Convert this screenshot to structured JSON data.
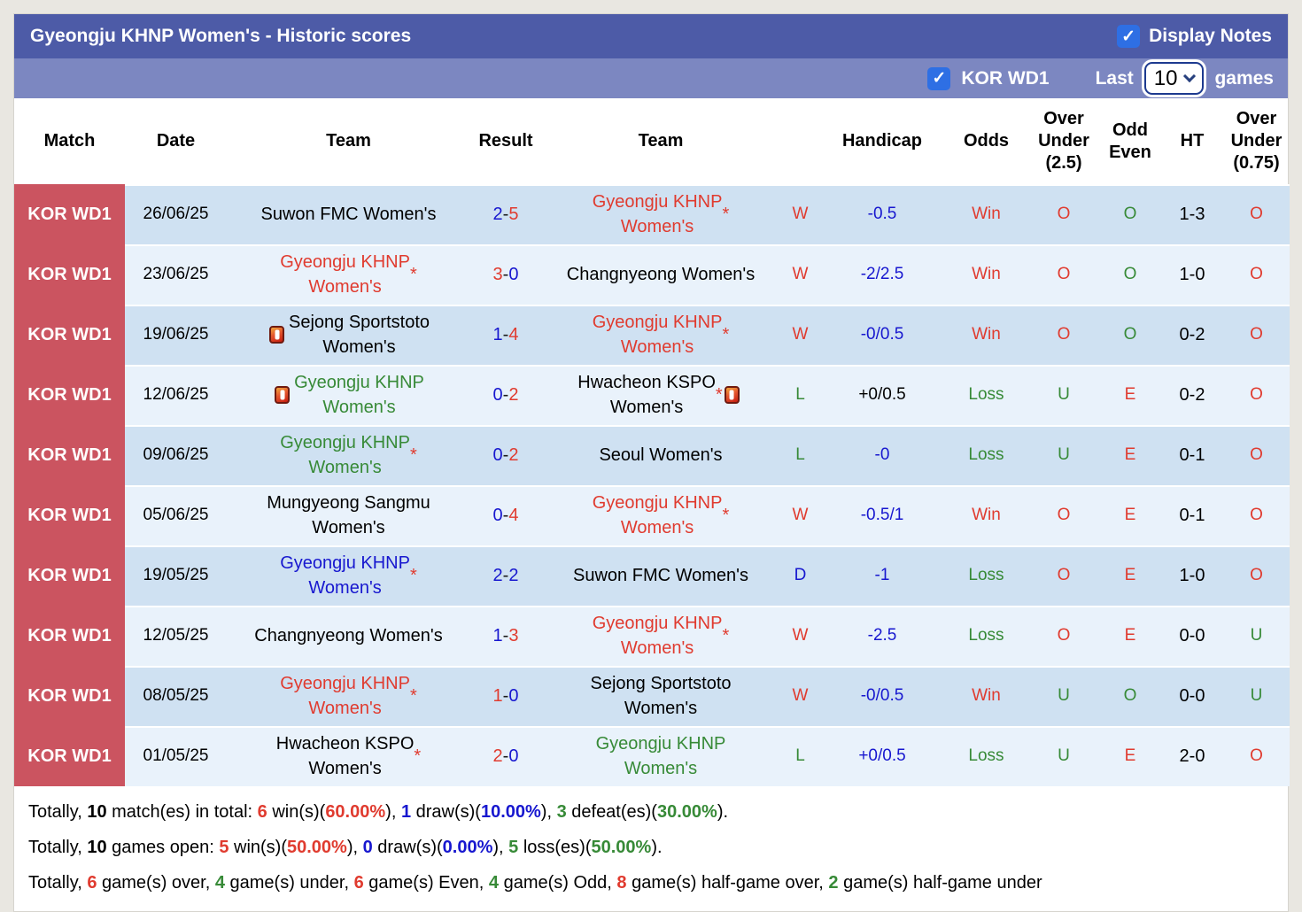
{
  "header": {
    "title": "Gyeongju KHNP Women's - Historic scores",
    "display_notes_label": "Display Notes"
  },
  "filter_bar": {
    "league_label": "KOR WD1",
    "last_label": "Last",
    "games_count": "10",
    "games_label": "games"
  },
  "colors": {
    "header_dark": "#4d5ba7",
    "header_light": "#7c87c1",
    "badge_red": "#cb5460",
    "row_odd": "#cfe1f2",
    "row_even": "#e9f2fb",
    "checkbox_blue": "#2e6fe4",
    "win_red": "#e03b2f",
    "loss_green": "#378a37",
    "draw_blue": "#1717cf"
  },
  "table": {
    "columns": [
      "Match",
      "Date",
      "Team",
      "Result",
      "Team",
      "",
      "Handicap",
      "Odds",
      "Over\nUnder\n(2.5)",
      "Odd\nEven",
      "HT",
      "Over\nUnder\n(0.75)"
    ],
    "rows": [
      {
        "league": "KOR WD1",
        "date": "26/06/25",
        "home": {
          "name": "Suwon FMC Women's",
          "color": "black",
          "star": false,
          "card_before": false,
          "card_after": false
        },
        "result": {
          "home": "2",
          "away": "5",
          "home_color": "blue",
          "away_color": "red"
        },
        "away": {
          "name": "Gyeongju KHNP\nWomen's",
          "color": "red",
          "star": true,
          "card_before": false,
          "card_after": false
        },
        "outcome": {
          "text": "W",
          "color": "red"
        },
        "handicap": {
          "text": "-0.5",
          "color": "blue"
        },
        "odds": {
          "text": "Win",
          "color": "red"
        },
        "over_under_25": {
          "text": "O",
          "color": "red"
        },
        "odd_even": {
          "text": "O",
          "color": "green"
        },
        "ht": "1-3",
        "over_under_075": {
          "text": "O",
          "color": "red"
        }
      },
      {
        "league": "KOR WD1",
        "date": "23/06/25",
        "home": {
          "name": "Gyeongju KHNP\nWomen's",
          "color": "red",
          "star": true,
          "card_before": false,
          "card_after": false
        },
        "result": {
          "home": "3",
          "away": "0",
          "home_color": "red",
          "away_color": "blue"
        },
        "away": {
          "name": "Changnyeong Women's",
          "color": "black",
          "star": false,
          "card_before": false,
          "card_after": false
        },
        "outcome": {
          "text": "W",
          "color": "red"
        },
        "handicap": {
          "text": "-2/2.5",
          "color": "blue"
        },
        "odds": {
          "text": "Win",
          "color": "red"
        },
        "over_under_25": {
          "text": "O",
          "color": "red"
        },
        "odd_even": {
          "text": "O",
          "color": "green"
        },
        "ht": "1-0",
        "over_under_075": {
          "text": "O",
          "color": "red"
        }
      },
      {
        "league": "KOR WD1",
        "date": "19/06/25",
        "home": {
          "name": "Sejong Sportstoto\nWomen's",
          "color": "black",
          "star": false,
          "card_before": true,
          "card_after": false
        },
        "result": {
          "home": "1",
          "away": "4",
          "home_color": "blue",
          "away_color": "red"
        },
        "away": {
          "name": "Gyeongju KHNP\nWomen's",
          "color": "red",
          "star": true,
          "card_before": false,
          "card_after": false
        },
        "outcome": {
          "text": "W",
          "color": "red"
        },
        "handicap": {
          "text": "-0/0.5",
          "color": "blue"
        },
        "odds": {
          "text": "Win",
          "color": "red"
        },
        "over_under_25": {
          "text": "O",
          "color": "red"
        },
        "odd_even": {
          "text": "O",
          "color": "green"
        },
        "ht": "0-2",
        "over_under_075": {
          "text": "O",
          "color": "red"
        }
      },
      {
        "league": "KOR WD1",
        "date": "12/06/25",
        "home": {
          "name": "Gyeongju KHNP\nWomen's",
          "color": "green",
          "star": false,
          "card_before": true,
          "card_after": false
        },
        "result": {
          "home": "0",
          "away": "2",
          "home_color": "blue",
          "away_color": "red"
        },
        "away": {
          "name": "Hwacheon KSPO\nWomen's",
          "color": "black",
          "star": true,
          "card_before": false,
          "card_after": true
        },
        "outcome": {
          "text": "L",
          "color": "green"
        },
        "handicap": {
          "text": "+0/0.5",
          "color": "black"
        },
        "odds": {
          "text": "Loss",
          "color": "green"
        },
        "over_under_25": {
          "text": "U",
          "color": "green"
        },
        "odd_even": {
          "text": "E",
          "color": "red"
        },
        "ht": "0-2",
        "over_under_075": {
          "text": "O",
          "color": "red"
        }
      },
      {
        "league": "KOR WD1",
        "date": "09/06/25",
        "home": {
          "name": "Gyeongju KHNP\nWomen's",
          "color": "green",
          "star": true,
          "card_before": false,
          "card_after": false
        },
        "result": {
          "home": "0",
          "away": "2",
          "home_color": "blue",
          "away_color": "red"
        },
        "away": {
          "name": "Seoul Women's",
          "color": "black",
          "star": false,
          "card_before": false,
          "card_after": false
        },
        "outcome": {
          "text": "L",
          "color": "green"
        },
        "handicap": {
          "text": "-0",
          "color": "blue"
        },
        "odds": {
          "text": "Loss",
          "color": "green"
        },
        "over_under_25": {
          "text": "U",
          "color": "green"
        },
        "odd_even": {
          "text": "E",
          "color": "red"
        },
        "ht": "0-1",
        "over_under_075": {
          "text": "O",
          "color": "red"
        }
      },
      {
        "league": "KOR WD1",
        "date": "05/06/25",
        "home": {
          "name": "Mungyeong Sangmu\nWomen's",
          "color": "black",
          "star": false,
          "card_before": false,
          "card_after": false
        },
        "result": {
          "home": "0",
          "away": "4",
          "home_color": "blue",
          "away_color": "red"
        },
        "away": {
          "name": "Gyeongju KHNP\nWomen's",
          "color": "red",
          "star": true,
          "card_before": false,
          "card_after": false
        },
        "outcome": {
          "text": "W",
          "color": "red"
        },
        "handicap": {
          "text": "-0.5/1",
          "color": "blue"
        },
        "odds": {
          "text": "Win",
          "color": "red"
        },
        "over_under_25": {
          "text": "O",
          "color": "red"
        },
        "odd_even": {
          "text": "E",
          "color": "red"
        },
        "ht": "0-1",
        "over_under_075": {
          "text": "O",
          "color": "red"
        }
      },
      {
        "league": "KOR WD1",
        "date": "19/05/25",
        "home": {
          "name": "Gyeongju KHNP\nWomen's",
          "color": "blue",
          "star": true,
          "card_before": false,
          "card_after": false
        },
        "result": {
          "home": "2",
          "away": "2",
          "home_color": "blue",
          "away_color": "blue"
        },
        "away": {
          "name": "Suwon FMC Women's",
          "color": "black",
          "star": false,
          "card_before": false,
          "card_after": false
        },
        "outcome": {
          "text": "D",
          "color": "blue"
        },
        "handicap": {
          "text": "-1",
          "color": "blue"
        },
        "odds": {
          "text": "Loss",
          "color": "green"
        },
        "over_under_25": {
          "text": "O",
          "color": "red"
        },
        "odd_even": {
          "text": "E",
          "color": "red"
        },
        "ht": "1-0",
        "over_under_075": {
          "text": "O",
          "color": "red"
        }
      },
      {
        "league": "KOR WD1",
        "date": "12/05/25",
        "home": {
          "name": "Changnyeong Women's",
          "color": "black",
          "star": false,
          "card_before": false,
          "card_after": false
        },
        "result": {
          "home": "1",
          "away": "3",
          "home_color": "blue",
          "away_color": "red"
        },
        "away": {
          "name": "Gyeongju KHNP\nWomen's",
          "color": "red",
          "star": true,
          "card_before": false,
          "card_after": false
        },
        "outcome": {
          "text": "W",
          "color": "red"
        },
        "handicap": {
          "text": "-2.5",
          "color": "blue"
        },
        "odds": {
          "text": "Loss",
          "color": "green"
        },
        "over_under_25": {
          "text": "O",
          "color": "red"
        },
        "odd_even": {
          "text": "E",
          "color": "red"
        },
        "ht": "0-0",
        "over_under_075": {
          "text": "U",
          "color": "green"
        }
      },
      {
        "league": "KOR WD1",
        "date": "08/05/25",
        "home": {
          "name": "Gyeongju KHNP\nWomen's",
          "color": "red",
          "star": true,
          "card_before": false,
          "card_after": false
        },
        "result": {
          "home": "1",
          "away": "0",
          "home_color": "red",
          "away_color": "blue"
        },
        "away": {
          "name": "Sejong Sportstoto\nWomen's",
          "color": "black",
          "star": false,
          "card_before": false,
          "card_after": false
        },
        "outcome": {
          "text": "W",
          "color": "red"
        },
        "handicap": {
          "text": "-0/0.5",
          "color": "blue"
        },
        "odds": {
          "text": "Win",
          "color": "red"
        },
        "over_under_25": {
          "text": "U",
          "color": "green"
        },
        "odd_even": {
          "text": "O",
          "color": "green"
        },
        "ht": "0-0",
        "over_under_075": {
          "text": "U",
          "color": "green"
        }
      },
      {
        "league": "KOR WD1",
        "date": "01/05/25",
        "home": {
          "name": "Hwacheon KSPO\nWomen's",
          "color": "black",
          "star": true,
          "card_before": false,
          "card_after": false
        },
        "result": {
          "home": "2",
          "away": "0",
          "home_color": "red",
          "away_color": "blue"
        },
        "away": {
          "name": "Gyeongju KHNP\nWomen's",
          "color": "green",
          "star": false,
          "card_before": false,
          "card_after": false
        },
        "outcome": {
          "text": "L",
          "color": "green"
        },
        "handicap": {
          "text": "+0/0.5",
          "color": "blue"
        },
        "odds": {
          "text": "Loss",
          "color": "green"
        },
        "over_under_25": {
          "text": "U",
          "color": "green"
        },
        "odd_even": {
          "text": "E",
          "color": "red"
        },
        "ht": "2-0",
        "over_under_075": {
          "text": "O",
          "color": "red"
        }
      }
    ]
  },
  "footer": {
    "lines": [
      [
        {
          "t": "Totally, "
        },
        {
          "t": "10",
          "b": true
        },
        {
          "t": " match(es) in total: "
        },
        {
          "t": "6",
          "b": true,
          "c": "red"
        },
        {
          "t": " win(s)("
        },
        {
          "t": "60.00%",
          "b": true,
          "c": "red"
        },
        {
          "t": "), "
        },
        {
          "t": "1",
          "b": true,
          "c": "blue"
        },
        {
          "t": " draw(s)("
        },
        {
          "t": "10.00%",
          "b": true,
          "c": "blue"
        },
        {
          "t": "), "
        },
        {
          "t": "3",
          "b": true,
          "c": "green"
        },
        {
          "t": " defeat(es)("
        },
        {
          "t": "30.00%",
          "b": true,
          "c": "green"
        },
        {
          "t": ")."
        }
      ],
      [
        {
          "t": "Totally, "
        },
        {
          "t": "10",
          "b": true
        },
        {
          "t": " games open: "
        },
        {
          "t": "5",
          "b": true,
          "c": "red"
        },
        {
          "t": " win(s)("
        },
        {
          "t": "50.00%",
          "b": true,
          "c": "red"
        },
        {
          "t": "), "
        },
        {
          "t": "0",
          "b": true,
          "c": "blue"
        },
        {
          "t": " draw(s)("
        },
        {
          "t": "0.00%",
          "b": true,
          "c": "blue"
        },
        {
          "t": "), "
        },
        {
          "t": "5",
          "b": true,
          "c": "green"
        },
        {
          "t": " loss(es)("
        },
        {
          "t": "50.00%",
          "b": true,
          "c": "green"
        },
        {
          "t": ")."
        }
      ],
      [
        {
          "t": "Totally, "
        },
        {
          "t": "6",
          "b": true,
          "c": "red"
        },
        {
          "t": " game(s) over, "
        },
        {
          "t": "4",
          "b": true,
          "c": "green"
        },
        {
          "t": " game(s) under, "
        },
        {
          "t": "6",
          "b": true,
          "c": "red"
        },
        {
          "t": " game(s) Even, "
        },
        {
          "t": "4",
          "b": true,
          "c": "green"
        },
        {
          "t": " game(s) Odd, "
        },
        {
          "t": "8",
          "b": true,
          "c": "red"
        },
        {
          "t": " game(s) half-game over, "
        },
        {
          "t": "2",
          "b": true,
          "c": "green"
        },
        {
          "t": " game(s) half-game under"
        }
      ]
    ]
  }
}
